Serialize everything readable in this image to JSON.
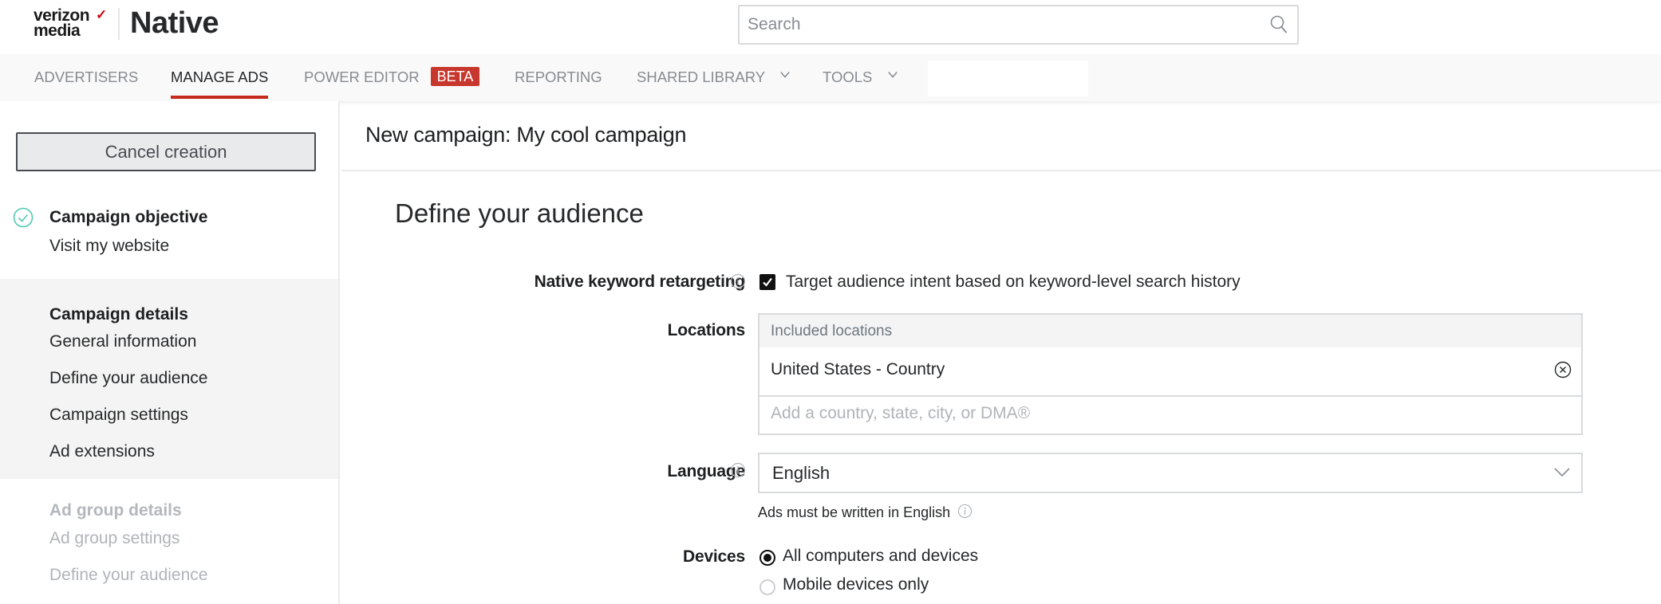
{
  "header": {
    "logo_line1": "verizon",
    "logo_line2": "media",
    "logo_mark": "✓",
    "product": "Native",
    "search_placeholder": "Search",
    "search_icon": "search-icon"
  },
  "nav": {
    "items": [
      {
        "label": "ADVERTISERS",
        "active": false
      },
      {
        "label": "MANAGE ADS",
        "active": true
      },
      {
        "label": "POWER EDITOR",
        "badge": "BETA",
        "active": false
      },
      {
        "label": "REPORTING",
        "active": false
      },
      {
        "label": "SHARED LIBRARY",
        "dropdown": true,
        "active": false
      },
      {
        "label": "TOOLS",
        "dropdown": true,
        "active": false
      }
    ],
    "accent_color": "#c52a1a"
  },
  "sidebar": {
    "cancel_label": "Cancel creation",
    "objective": {
      "title": "Campaign objective",
      "value": "Visit my website",
      "status": "complete"
    },
    "campaign_details": {
      "title": "Campaign details",
      "items": [
        "General information",
        "Define your audience",
        "Campaign settings",
        "Ad extensions"
      ]
    },
    "ad_group_details": {
      "title": "Ad group details",
      "items": [
        "Ad group settings",
        "Define your audience"
      ],
      "disabled": true
    }
  },
  "main": {
    "page_title": "New campaign: My cool campaign",
    "section_title": "Define your audience",
    "keyword_retargeting": {
      "label": "Native keyword retargeting",
      "checked": true,
      "checkbox_label": "Target audience intent based on keyword-level search history"
    },
    "locations": {
      "label": "Locations",
      "header": "Included locations",
      "included": [
        "United States - Country"
      ],
      "placeholder": "Add a country, state, city, or DMA®"
    },
    "language": {
      "label": "Language",
      "value": "English",
      "hint": "Ads must be written in English"
    },
    "devices": {
      "label": "Devices",
      "options": [
        {
          "label": "All computers and devices",
          "selected": true
        },
        {
          "label": "Mobile devices only",
          "selected": false
        }
      ]
    }
  }
}
